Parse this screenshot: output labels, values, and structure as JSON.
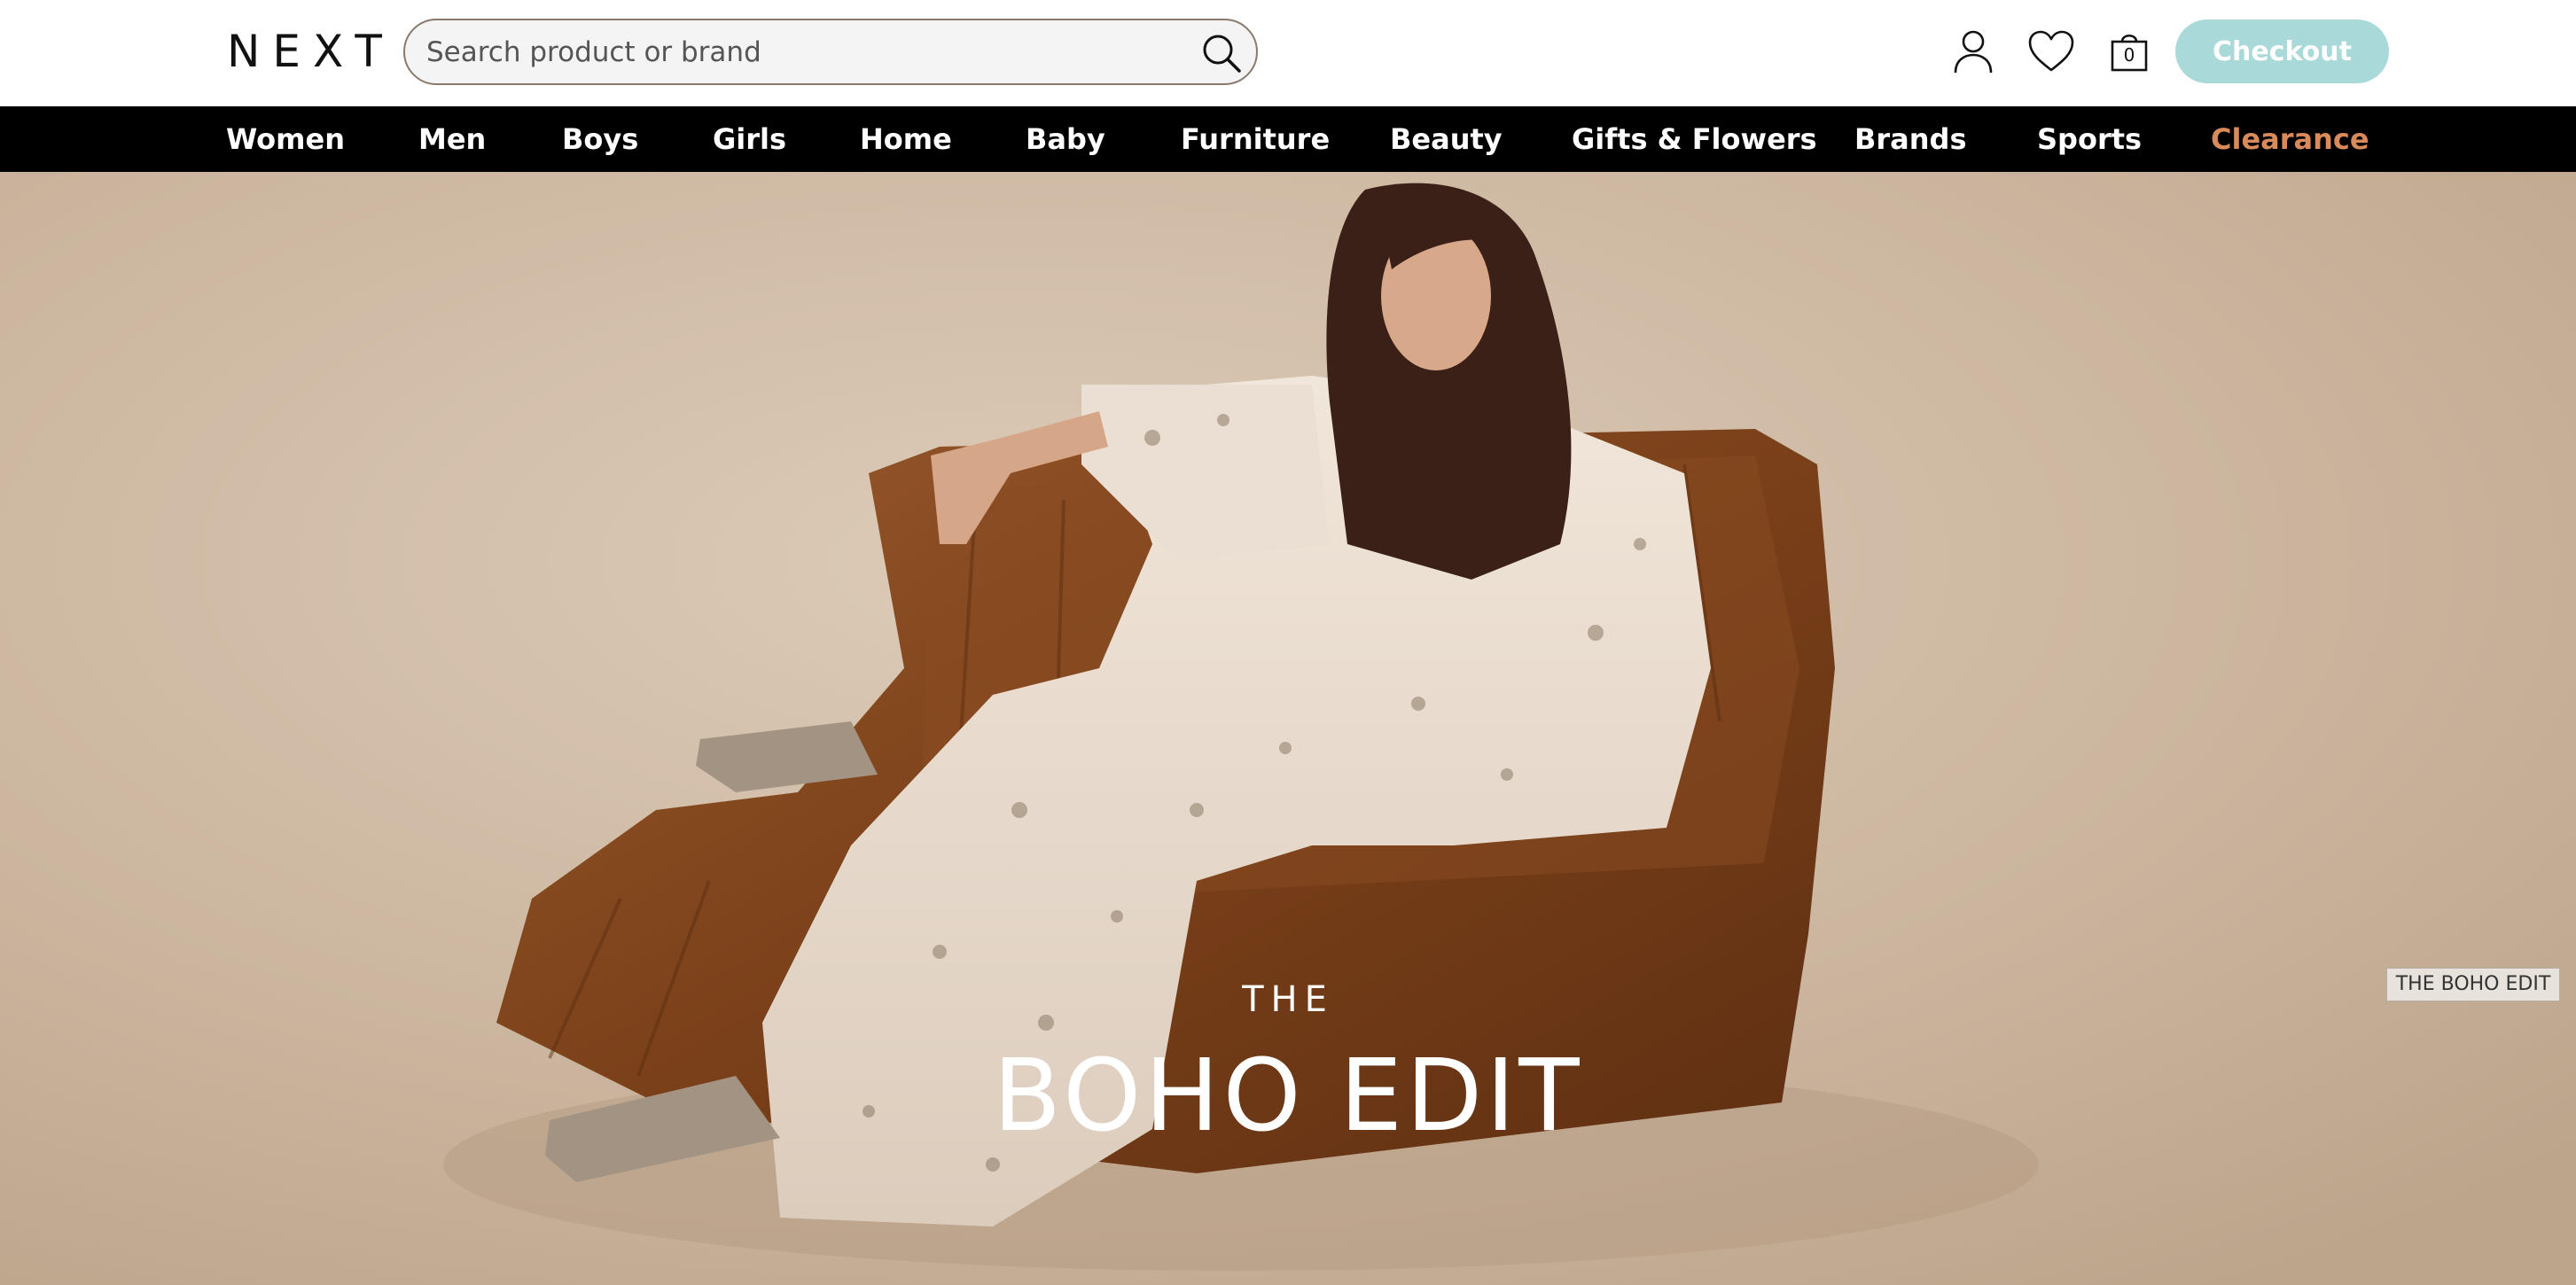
{
  "header": {
    "logo": "NEXT",
    "search_placeholder": "Search product or brand",
    "icons": [
      "search-icon",
      "account-icon",
      "heart-icon",
      "bag-icon"
    ],
    "bag_count": "0",
    "checkout_label": "Checkout"
  },
  "nav": {
    "items": [
      {
        "label": "Women"
      },
      {
        "label": "Men"
      },
      {
        "label": "Boys"
      },
      {
        "label": "Girls"
      },
      {
        "label": "Home"
      },
      {
        "label": "Baby"
      },
      {
        "label": "Furniture"
      },
      {
        "label": "Beauty"
      },
      {
        "label": "Gifts & Flowers"
      },
      {
        "label": "Brands"
      },
      {
        "label": "Sports"
      },
      {
        "label": "Clearance"
      }
    ]
  },
  "hero": {
    "kicker": "THE",
    "title": "BOHO EDIT",
    "side_tag": "THE BOHO EDIT"
  },
  "colors": {
    "nav_bg": "#000000",
    "checkout_bg": "#a9d9d8",
    "clearance": "#d98a5a",
    "hero_bg": "#cdb8a1"
  }
}
